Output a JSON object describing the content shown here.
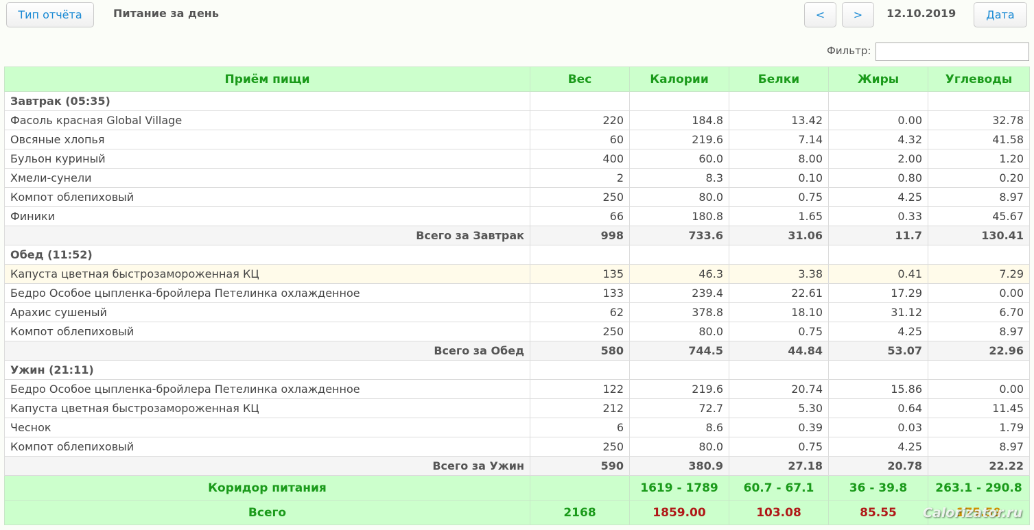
{
  "header": {
    "report_type_button": "Тип отчёта",
    "title": "Питание за день",
    "prev_button": "<",
    "next_button": ">",
    "date": "12.10.2019",
    "date_button": "Дата"
  },
  "filter": {
    "label": "Фильтр:",
    "value": ""
  },
  "table": {
    "columns": [
      "Приём пищи",
      "Вес",
      "Калории",
      "Белки",
      "Жиры",
      "Углеводы"
    ],
    "meals": [
      {
        "title": "Завтрак (05:35)",
        "items": [
          {
            "name": "Фасоль красная Global Village",
            "weight": "220",
            "kcal": "184.8",
            "protein": "13.42",
            "fat": "0.00",
            "carbs": "32.78"
          },
          {
            "name": "Овсяные хлопья",
            "weight": "60",
            "kcal": "219.6",
            "protein": "7.14",
            "fat": "4.32",
            "carbs": "41.58"
          },
          {
            "name": "Бульон куриный",
            "weight": "400",
            "kcal": "60.0",
            "protein": "8.00",
            "fat": "2.00",
            "carbs": "1.20"
          },
          {
            "name": "Хмели-сунели",
            "weight": "2",
            "kcal": "8.3",
            "protein": "0.10",
            "fat": "0.80",
            "carbs": "0.20"
          },
          {
            "name": "Компот облепиховый",
            "weight": "250",
            "kcal": "80.0",
            "protein": "0.75",
            "fat": "4.25",
            "carbs": "8.97"
          },
          {
            "name": "Финики",
            "weight": "66",
            "kcal": "180.8",
            "protein": "1.65",
            "fat": "0.33",
            "carbs": "45.67"
          }
        ],
        "total": {
          "label": "Всего за Завтрак",
          "weight": "998",
          "kcal": "733.6",
          "protein": "31.06",
          "fat": "11.7",
          "carbs": "130.41"
        }
      },
      {
        "title": "Обед (11:52)",
        "items": [
          {
            "name": "Капуста цветная быстрозамороженная КЦ",
            "weight": "135",
            "kcal": "46.3",
            "protein": "3.38",
            "fat": "0.41",
            "carbs": "7.29"
          },
          {
            "name": "Бедро Особое цыпленка-бройлера Петелинка охлажденное",
            "weight": "133",
            "kcal": "239.4",
            "protein": "22.61",
            "fat": "17.29",
            "carbs": "0.00"
          },
          {
            "name": "Арахис сушеный",
            "weight": "62",
            "kcal": "378.8",
            "protein": "18.10",
            "fat": "31.12",
            "carbs": "6.70"
          },
          {
            "name": "Компот облепиховый",
            "weight": "250",
            "kcal": "80.0",
            "protein": "0.75",
            "fat": "4.25",
            "carbs": "8.97"
          }
        ],
        "total": {
          "label": "Всего за Обед",
          "weight": "580",
          "kcal": "744.5",
          "protein": "44.84",
          "fat": "53.07",
          "carbs": "22.96"
        }
      },
      {
        "title": "Ужин (21:11)",
        "items": [
          {
            "name": "Бедро Особое цыпленка-бройлера Петелинка охлажденное",
            "weight": "122",
            "kcal": "219.6",
            "protein": "20.74",
            "fat": "15.86",
            "carbs": "0.00"
          },
          {
            "name": "Капуста цветная быстрозамороженная КЦ",
            "weight": "212",
            "kcal": "72.7",
            "protein": "5.30",
            "fat": "0.64",
            "carbs": "11.45"
          },
          {
            "name": "Чеснок",
            "weight": "6",
            "kcal": "8.6",
            "protein": "0.39",
            "fat": "0.03",
            "carbs": "1.79"
          },
          {
            "name": "Компот облепиховый",
            "weight": "250",
            "kcal": "80.0",
            "protein": "0.75",
            "fat": "4.25",
            "carbs": "8.97"
          }
        ],
        "total": {
          "label": "Всего за Ужин",
          "weight": "590",
          "kcal": "380.9",
          "protein": "27.18",
          "fat": "20.78",
          "carbs": "22.22"
        }
      }
    ],
    "corridor": {
      "label": "Коридор питания",
      "weight": "",
      "kcal": "1619 - 1789",
      "protein": "60.7 - 67.1",
      "fat": "36 - 39.8",
      "carbs": "263.1 - 290.8"
    },
    "grand_total": {
      "label": "Всего",
      "weight": "2168",
      "kcal": "1859.00",
      "protein": "103.08",
      "fat": "85.55",
      "carbs": "175.59"
    }
  },
  "watermark": "Calorizator.ru",
  "colors": {
    "header_bg": "#ccffcc",
    "header_text": "#1a9a1a",
    "over_limit": "#b01818",
    "under_limit": "#d09000",
    "button_text": "#1a8ad4"
  }
}
